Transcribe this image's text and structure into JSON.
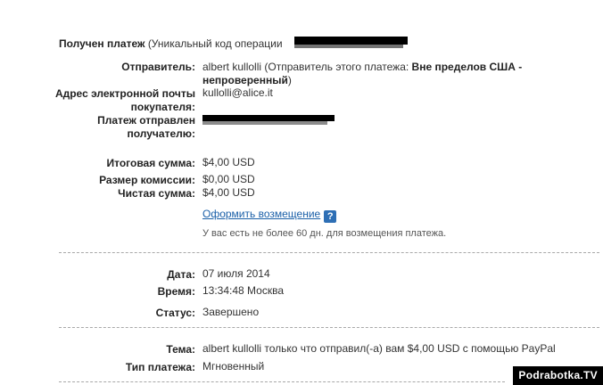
{
  "header": {
    "title_bold": "Получен платеж",
    "title_rest": "(Уникальный код операции"
  },
  "sender": {
    "label": "Отправитель:",
    "value_prefix": "albert kullolli (Отправитель этого платежа:",
    "value_bold": "Вне пределов США - непроверенный",
    "value_suffix": ")"
  },
  "buyer_email": {
    "label_line1": "Адрес электронной почты",
    "label_line2": "покупателя:",
    "value": "kullolli@alice.it"
  },
  "sent_to": {
    "label_line1": "Платеж отправлен",
    "label_line2": "получателю:"
  },
  "amounts": {
    "total_label": "Итоговая сумма:",
    "total_value": "$4,00 USD",
    "fee_label": "Размер комиссии:",
    "fee_value": "$0,00 USD",
    "net_label": "Чистая сумма:",
    "net_value": "$4,00 USD"
  },
  "refund": {
    "link_label": "Оформить возмещение",
    "help_icon": "?",
    "note": "У вас есть не более 60 дн. для возмещения платежа."
  },
  "details": {
    "date_label": "Дата:",
    "date_value": "07 июля 2014",
    "time_label": "Время:",
    "time_value": "13:34:48 Москва",
    "status_label": "Статус:",
    "status_value": "Завершено"
  },
  "subject": {
    "label": "Тема:",
    "value": "albert kullolli только что отправил(-а) вам $4,00 USD с помощью PayPal"
  },
  "payment_type": {
    "label": "Тип платежа:",
    "value": "Мгновенный"
  },
  "watermark": "Podrabotka.TV",
  "colors": {
    "link": "#1a5fa8",
    "help_icon_bg": "#2e6fb5",
    "redaction": "#000000"
  }
}
